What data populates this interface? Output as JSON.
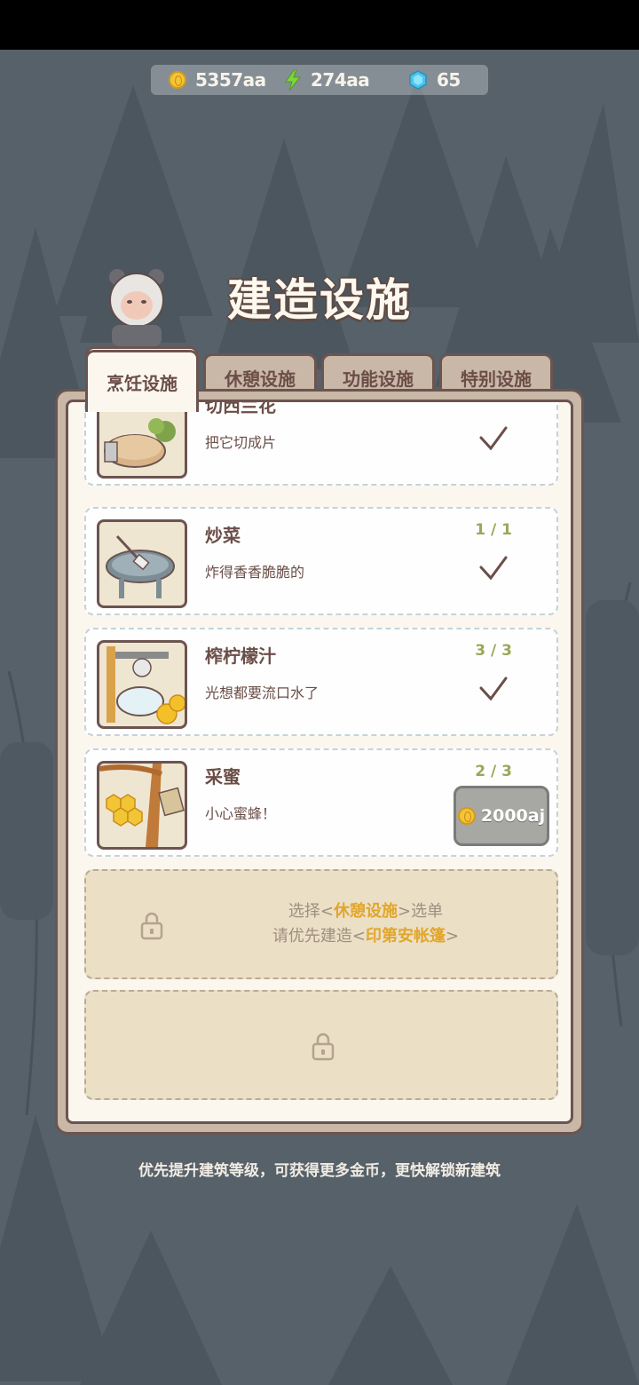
{
  "resources": {
    "coins": "5357aa",
    "energy": "274aa",
    "gems": "65"
  },
  "title": "建造设施",
  "tabs": [
    {
      "label": "烹饪设施"
    },
    {
      "label": "休憩设施"
    },
    {
      "label": "功能设施"
    },
    {
      "label": "特别设施"
    }
  ],
  "items": [
    {
      "name": "切西兰花",
      "desc": "把它切成片",
      "icon": "check-icon"
    },
    {
      "name": "炒菜",
      "desc": "炸得香香脆脆的",
      "count": "1 / 1",
      "icon": "check-icon"
    },
    {
      "name": "榨柠檬汁",
      "desc": "光想都要流口水了",
      "count": "3 / 3",
      "icon": "check-icon"
    },
    {
      "name": "采蜜",
      "desc": "小心蜜蜂！",
      "count": "2 / 3",
      "price": "2000aj"
    }
  ],
  "locked": {
    "line1_pre": "选择<",
    "line1_hl": "休憩设施",
    "line1_post": ">选单",
    "line2_pre": "请优先建造<",
    "line2_hl": "印第安帐篷",
    "line2_post": ">"
  },
  "footer_tip": "优先提升建筑等级，可获得更多金币，更快解锁新建筑",
  "colors": {
    "panel_border": "#6c5450",
    "count_green": "#98a85a",
    "highlight_orange": "#e2a62a"
  }
}
